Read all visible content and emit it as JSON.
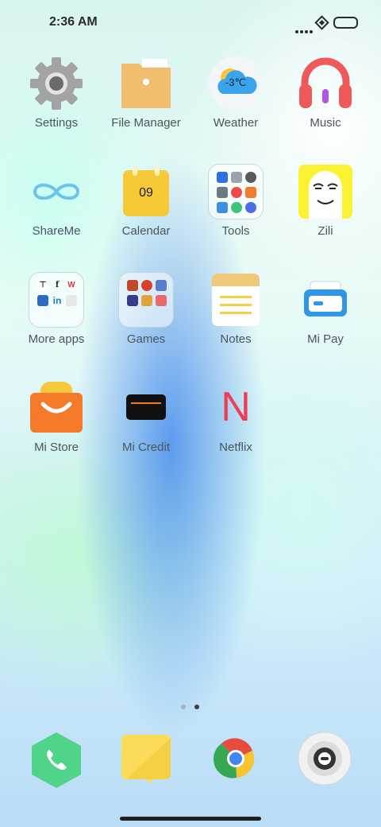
{
  "status_bar": {
    "time": "2:36 AM"
  },
  "apps": {
    "settings": "Settings",
    "file_manager": "File Manager",
    "weather": "Weather",
    "weather_temp": "-3℃",
    "music": "Music",
    "shareme": "ShareMe",
    "calendar": "Calendar",
    "calendar_day": "09",
    "tools": "Tools",
    "zili": "Zili",
    "more_apps": "More apps",
    "games": "Games",
    "notes": "Notes",
    "mi_pay": "Mi Pay",
    "mi_store": "Mi Store",
    "mi_credit": "Mi Credit",
    "netflix": "Netflix",
    "netflix_glyph": "N"
  },
  "more_apps_folder": {
    "f_glyph": "f",
    "w_glyph": "W",
    "in_glyph": "in"
  },
  "pager": {
    "pages": 2,
    "active_page": 2
  },
  "dock": [
    "phone-icon",
    "messages-icon",
    "chrome-icon",
    "camera-icon"
  ],
  "colors": {
    "label": "#4a5560",
    "music_red": "#ee5a5a",
    "calendar_yellow": "#f7c936",
    "netflix_red": "#ee3e56",
    "phone_green": "#4fd48a",
    "mi_store_orange": "#f77a2a"
  }
}
